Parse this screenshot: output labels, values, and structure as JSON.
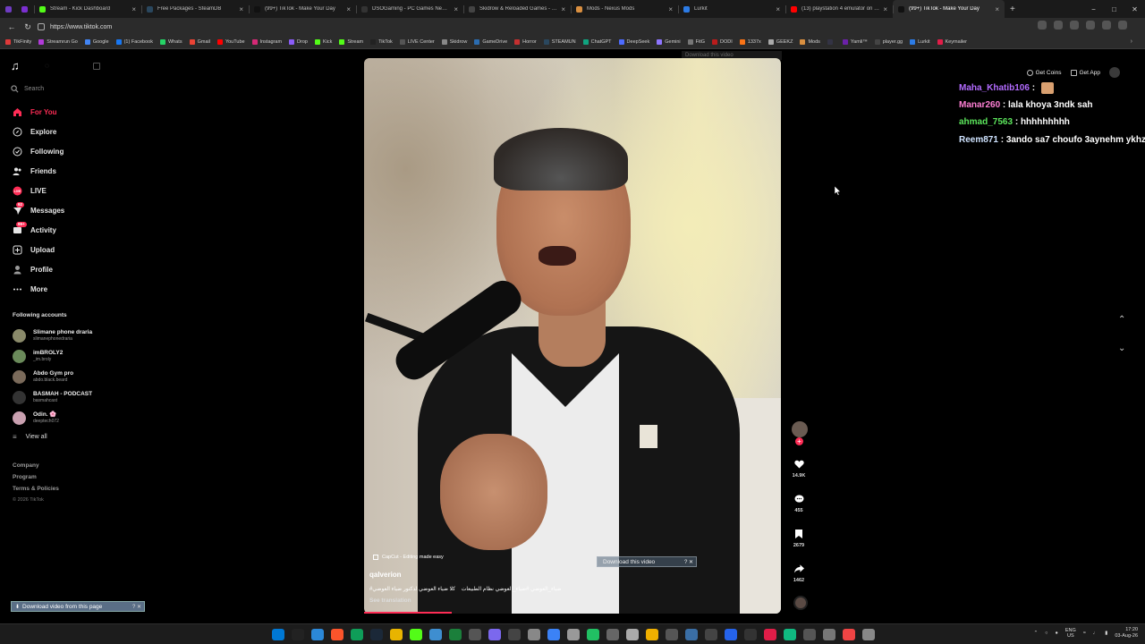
{
  "browser": {
    "tabs": [
      {
        "label": "",
        "color": "#6f3cc2"
      },
      {
        "label": "",
        "color": "#7b2fd0"
      },
      {
        "label": "Stream - Kick Dashboard",
        "color": "#53fc18"
      },
      {
        "label": "Free Packages - SteamDB",
        "color": "#2a475e"
      },
      {
        "label": "(99+) TikTok - Make Your Day",
        "color": "#111"
      },
      {
        "label": "DSOGaming - PC Games News, S...",
        "color": "#333"
      },
      {
        "label": "Skidrow & Reloaded Games - Do...",
        "color": "#444"
      },
      {
        "label": "Mods - Nexus Mods",
        "color": "#d98f40"
      },
      {
        "label": "Lurkit",
        "color": "#2c7be5"
      },
      {
        "label": "(13) playstation 4 emulator on pc...",
        "color": "#ff0000"
      },
      {
        "label": "(99+) TikTok - Make Your Day",
        "color": "#111",
        "active": true
      }
    ],
    "new_tab": "+",
    "window_controls": {
      "minimize": "−",
      "maximize": "□",
      "close": "✕"
    },
    "url": "https://www.tiktok.com",
    "bookmarks": [
      {
        "label": "TikFinity",
        "color": "#e03a3a"
      },
      {
        "label": "Streamrun Go",
        "color": "#b13ad9"
      },
      {
        "label": "Google",
        "color": "#4285f4"
      },
      {
        "label": "(1) Facebook",
        "color": "#1877f2"
      },
      {
        "label": "Whats",
        "color": "#25d366"
      },
      {
        "label": "Gmail",
        "color": "#ea4335"
      },
      {
        "label": "YouTube",
        "color": "#ff0000"
      },
      {
        "label": "Instagram",
        "color": "#d62976"
      },
      {
        "label": "Drop",
        "color": "#8a5cf6"
      },
      {
        "label": "Kick",
        "color": "#53fc18"
      },
      {
        "label": "Stream",
        "color": "#53fc18"
      },
      {
        "label": "TikTok",
        "color": "#222"
      },
      {
        "label": "LIVE Center",
        "color": "#555"
      },
      {
        "label": "Skidrow",
        "color": "#888"
      },
      {
        "label": "GameDrive",
        "color": "#2b6cb0"
      },
      {
        "label": "Horror",
        "color": "#c53030"
      },
      {
        "label": "STEAMUN",
        "color": "#2a475e"
      },
      {
        "label": "ChatGPT",
        "color": "#10a37f"
      },
      {
        "label": "DeepSeek",
        "color": "#4d6bfe"
      },
      {
        "label": "Gemini",
        "color": "#8e75ff"
      },
      {
        "label": "FitG",
        "color": "#777"
      },
      {
        "label": "DODI",
        "color": "#b91c1c"
      },
      {
        "label": "1337x",
        "color": "#f97316"
      },
      {
        "label": "GEEKZ",
        "color": "#aaa"
      },
      {
        "label": "Mods",
        "color": "#d98f40"
      },
      {
        "label": "",
        "color": "#334"
      },
      {
        "label": "Yamli™",
        "color": "#6b21a8"
      },
      {
        "label": "player.gg",
        "color": "#444"
      },
      {
        "label": "Lurkit",
        "color": "#2c7be5"
      },
      {
        "label": "Keymailer",
        "color": "#e11d48"
      }
    ]
  },
  "sidebar": {
    "search_placeholder": "Search",
    "nav": [
      {
        "label": "For You",
        "icon": "home-icon",
        "active": true
      },
      {
        "label": "Explore",
        "icon": "compass-icon"
      },
      {
        "label": "Following",
        "icon": "following-icon"
      },
      {
        "label": "Friends",
        "icon": "friends-icon"
      },
      {
        "label": "LIVE",
        "icon": "live-icon"
      },
      {
        "label": "Messages",
        "icon": "messages-icon",
        "badge": "92"
      },
      {
        "label": "Activity",
        "icon": "activity-icon",
        "badge": "99+"
      },
      {
        "label": "Upload",
        "icon": "upload-icon"
      },
      {
        "label": "Profile",
        "icon": "profile-icon"
      },
      {
        "label": "More",
        "icon": "more-icon"
      }
    ],
    "following_title": "Following accounts",
    "accounts": [
      {
        "name": "Slimane phone draria",
        "handle": "slimanephonedraria",
        "color": "#8a8a6a"
      },
      {
        "name": "imBROLY2",
        "handle": "_im.broly",
        "color": "#6a8a5a"
      },
      {
        "name": "Abdo Gym pro",
        "handle": "abdo.black.beard",
        "color": "#7a6a5a"
      },
      {
        "name": "BASMAH - PODCAST",
        "handle": "basmahcast",
        "color": "#333"
      },
      {
        "name": "Odin. 🌸",
        "handle": "deeptech072",
        "color": "#c9a0b0"
      }
    ],
    "view_all": "View all",
    "footer": [
      "Company",
      "Program",
      "Terms & Policies"
    ],
    "copyright": "© 2026 TikTok"
  },
  "download_bar": {
    "label": "Download video from this page",
    "help": "?",
    "close": "✕"
  },
  "video": {
    "capcut": "CapCut - Editing made easy",
    "author": "qalverion",
    "caption": "#ضياء_العوضي #ضياء_العوضي نظام الطبيعات    كلا ضياء العوضي لدكتور ضياء العوضي",
    "see_translation": "See translation",
    "download_video": "Download this video",
    "download_top": "Download this video",
    "progress": 0.21
  },
  "actions": {
    "likes": "14.9K",
    "comments": "455",
    "saves": "2679",
    "shares": "1462"
  },
  "topbar": {
    "get_coins": "Get Coins",
    "get_app": "Get App"
  },
  "chat": [
    {
      "user": "Maha_Khatib106",
      "sep": " : ",
      "msg": "",
      "color": "#b36bff",
      "emote": true
    },
    {
      "user": "Manar260",
      "sep": " : ",
      "msg": "lala khoya 3ndk sah",
      "color": "#ff7fd5"
    },
    {
      "user": "ahmad_7563",
      "sep": " : ",
      "msg": "hhhhhhhhh",
      "color": "#5ce65c"
    },
    {
      "user": "Reem871",
      "sep": " : ",
      "msg": "3ando sa7 choufo 3aynehm ykhzro",
      "color": "#cfe3ff"
    }
  ],
  "taskbar": {
    "icons": [
      "#0078d4",
      "#222",
      "#2b88d8",
      "#fb542b",
      "#0f9d58",
      "#1b2838",
      "#e8b400",
      "#53fc18",
      "#3e8ed0",
      "#1b7f3b",
      "#555",
      "#7b68ee",
      "#444",
      "#888",
      "#3b82f6",
      "#999",
      "#21c063",
      "#666",
      "#aaa",
      "#f0b000",
      "#555",
      "#3a6ea5",
      "#444",
      "#2563eb",
      "#333",
      "#e11d48",
      "#10b981",
      "#555",
      "#777",
      "#ef4444",
      "#888"
    ],
    "lang": "ENG",
    "region": "US",
    "time": "17:20",
    "date": "03-Aug-26"
  },
  "colors": {
    "accent": "#fe2c55",
    "background": "#000000"
  }
}
